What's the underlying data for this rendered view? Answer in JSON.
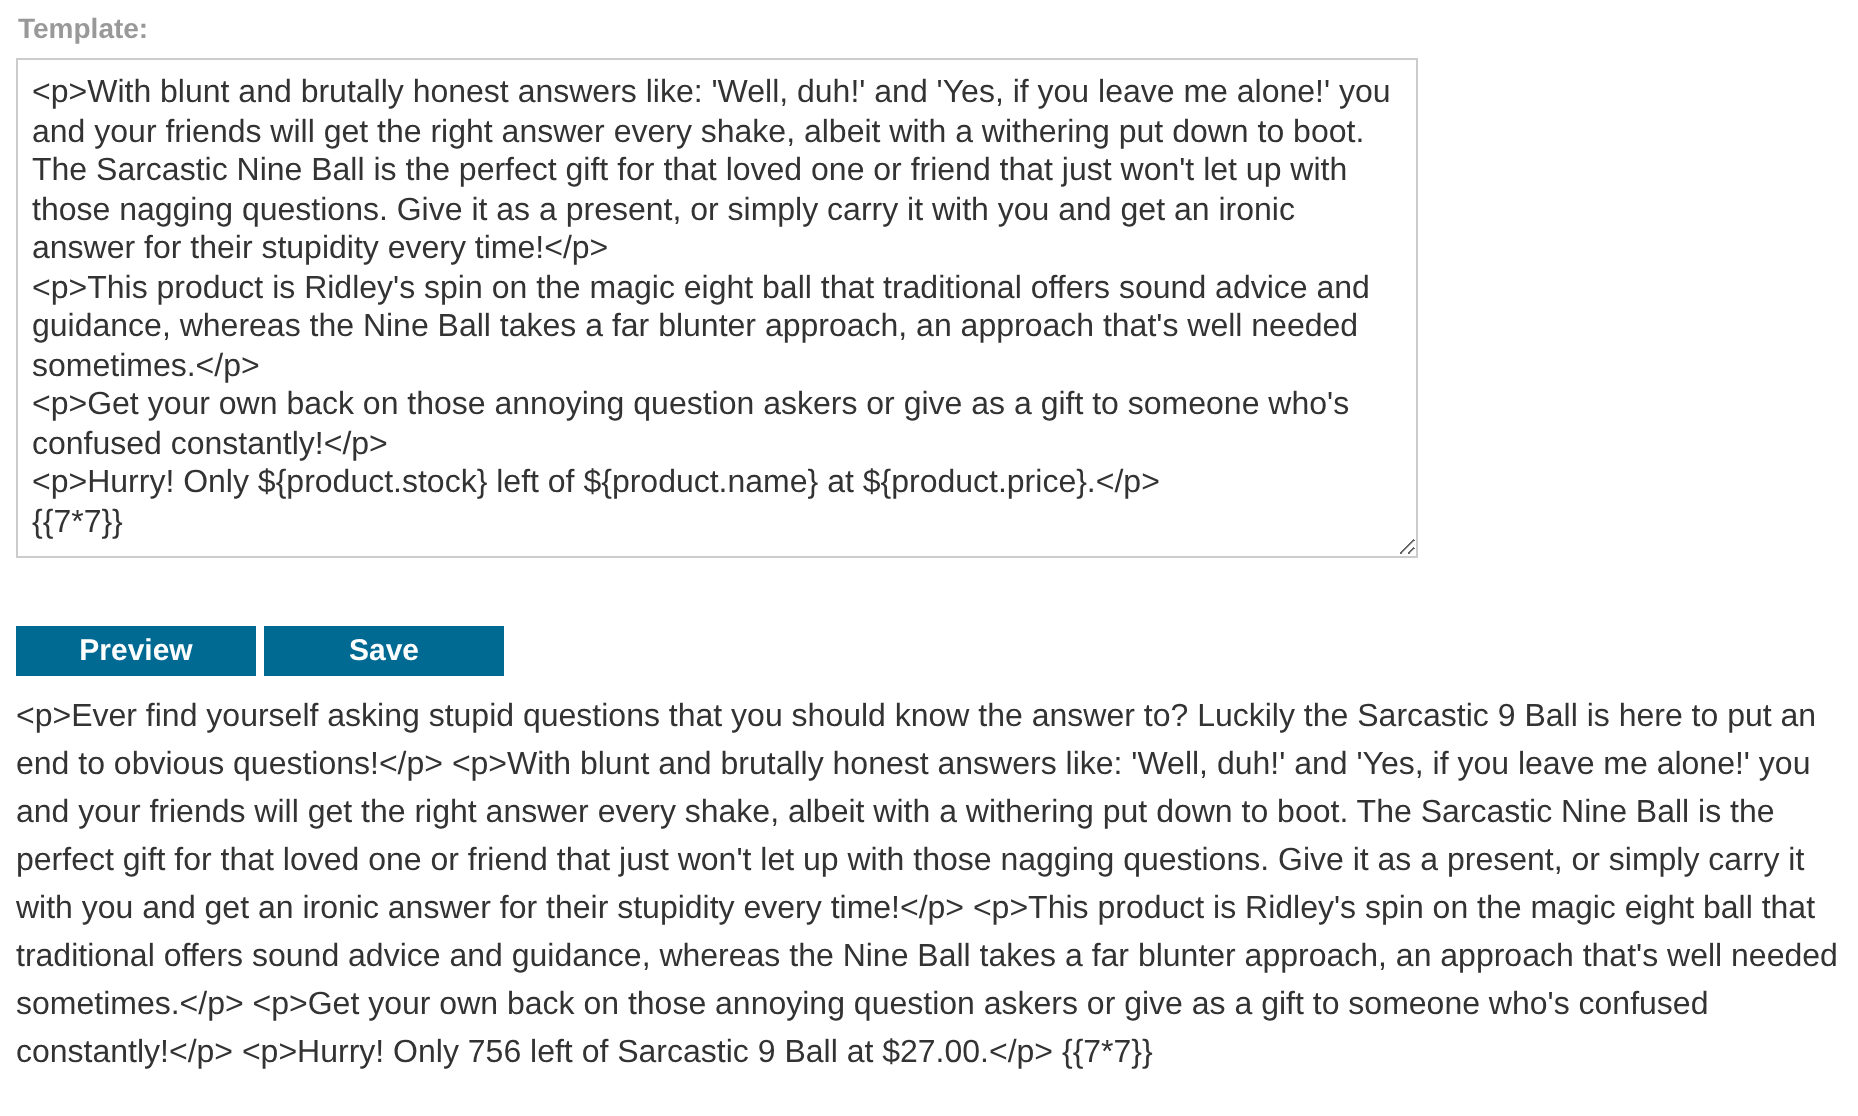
{
  "template": {
    "label": "Template:",
    "value": "<p>With blunt and brutally honest answers like: 'Well, duh!' and 'Yes, if you leave me alone!' you and your friends will get the right answer every shake, albeit with a withering put down to boot. The Sarcastic Nine Ball is the perfect gift for that loved one or friend that just won't let up with those nagging questions. Give it as a present, or simply carry it with you and get an ironic answer for their stupidity every time!</p>\n<p>This product is Ridley's spin on the magic eight ball that traditional offers sound advice and guidance, whereas the Nine Ball takes a far blunter approach, an approach that's well needed sometimes.</p>\n<p>Get your own back on those annoying question askers or give as a gift to someone who's confused constantly!</p>\n<p>Hurry! Only ${product.stock} left of ${product.name} at ${product.price}.</p>\n{{7*7}}"
  },
  "buttons": [
    {
      "label": "Preview"
    },
    {
      "label": "Save"
    }
  ],
  "preview": "<p>Ever find yourself asking stupid questions that you should know the answer to? Luckily the Sarcastic 9 Ball is here to put an end to obvious questions!</p> <p>With blunt and brutally honest answers like: 'Well, duh!' and 'Yes, if you leave me alone!' you and your friends will get the right answer every shake, albeit with a withering put down to boot. The Sarcastic Nine Ball is the perfect gift for that loved one or friend that just won't let up with those nagging questions. Give it as a present, or simply carry it with you and get an ironic answer for their stupidity every time!</p> <p>This product is Ridley's spin on the magic eight ball that traditional offers sound advice and guidance, whereas the Nine Ball takes a far blunter approach, an approach that's well needed sometimes.</p> <p>Get your own back on those annoying question askers or give as a gift to someone who's confused constantly!</p> <p>Hurry! Only 756 left of Sarcastic 9 Ball at $27.00.</p> {{7*7}}"
}
